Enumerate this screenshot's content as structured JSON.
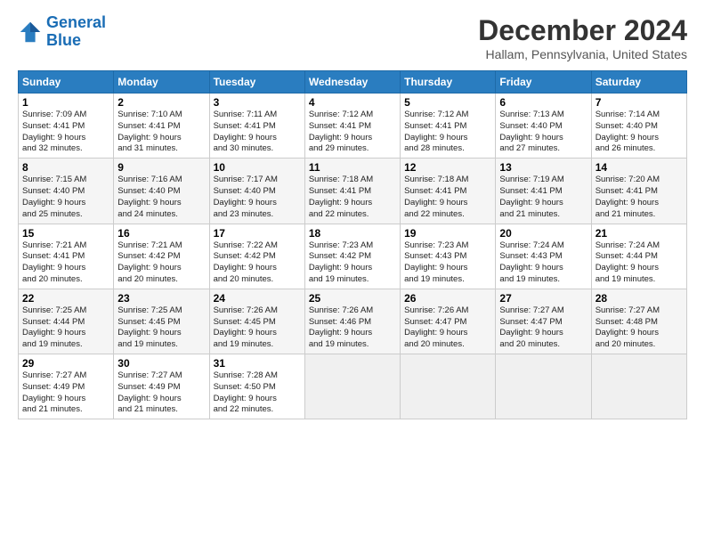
{
  "logo": {
    "line1": "General",
    "line2": "Blue"
  },
  "title": "December 2024",
  "location": "Hallam, Pennsylvania, United States",
  "headers": [
    "Sunday",
    "Monday",
    "Tuesday",
    "Wednesday",
    "Thursday",
    "Friday",
    "Saturday"
  ],
  "weeks": [
    [
      {
        "day": "1",
        "text": "Sunrise: 7:09 AM\nSunset: 4:41 PM\nDaylight: 9 hours\nand 32 minutes."
      },
      {
        "day": "2",
        "text": "Sunrise: 7:10 AM\nSunset: 4:41 PM\nDaylight: 9 hours\nand 31 minutes."
      },
      {
        "day": "3",
        "text": "Sunrise: 7:11 AM\nSunset: 4:41 PM\nDaylight: 9 hours\nand 30 minutes."
      },
      {
        "day": "4",
        "text": "Sunrise: 7:12 AM\nSunset: 4:41 PM\nDaylight: 9 hours\nand 29 minutes."
      },
      {
        "day": "5",
        "text": "Sunrise: 7:12 AM\nSunset: 4:41 PM\nDaylight: 9 hours\nand 28 minutes."
      },
      {
        "day": "6",
        "text": "Sunrise: 7:13 AM\nSunset: 4:40 PM\nDaylight: 9 hours\nand 27 minutes."
      },
      {
        "day": "7",
        "text": "Sunrise: 7:14 AM\nSunset: 4:40 PM\nDaylight: 9 hours\nand 26 minutes."
      }
    ],
    [
      {
        "day": "8",
        "text": "Sunrise: 7:15 AM\nSunset: 4:40 PM\nDaylight: 9 hours\nand 25 minutes."
      },
      {
        "day": "9",
        "text": "Sunrise: 7:16 AM\nSunset: 4:40 PM\nDaylight: 9 hours\nand 24 minutes."
      },
      {
        "day": "10",
        "text": "Sunrise: 7:17 AM\nSunset: 4:40 PM\nDaylight: 9 hours\nand 23 minutes."
      },
      {
        "day": "11",
        "text": "Sunrise: 7:18 AM\nSunset: 4:41 PM\nDaylight: 9 hours\nand 22 minutes."
      },
      {
        "day": "12",
        "text": "Sunrise: 7:18 AM\nSunset: 4:41 PM\nDaylight: 9 hours\nand 22 minutes."
      },
      {
        "day": "13",
        "text": "Sunrise: 7:19 AM\nSunset: 4:41 PM\nDaylight: 9 hours\nand 21 minutes."
      },
      {
        "day": "14",
        "text": "Sunrise: 7:20 AM\nSunset: 4:41 PM\nDaylight: 9 hours\nand 21 minutes."
      }
    ],
    [
      {
        "day": "15",
        "text": "Sunrise: 7:21 AM\nSunset: 4:41 PM\nDaylight: 9 hours\nand 20 minutes."
      },
      {
        "day": "16",
        "text": "Sunrise: 7:21 AM\nSunset: 4:42 PM\nDaylight: 9 hours\nand 20 minutes."
      },
      {
        "day": "17",
        "text": "Sunrise: 7:22 AM\nSunset: 4:42 PM\nDaylight: 9 hours\nand 20 minutes."
      },
      {
        "day": "18",
        "text": "Sunrise: 7:23 AM\nSunset: 4:42 PM\nDaylight: 9 hours\nand 19 minutes."
      },
      {
        "day": "19",
        "text": "Sunrise: 7:23 AM\nSunset: 4:43 PM\nDaylight: 9 hours\nand 19 minutes."
      },
      {
        "day": "20",
        "text": "Sunrise: 7:24 AM\nSunset: 4:43 PM\nDaylight: 9 hours\nand 19 minutes."
      },
      {
        "day": "21",
        "text": "Sunrise: 7:24 AM\nSunset: 4:44 PM\nDaylight: 9 hours\nand 19 minutes."
      }
    ],
    [
      {
        "day": "22",
        "text": "Sunrise: 7:25 AM\nSunset: 4:44 PM\nDaylight: 9 hours\nand 19 minutes."
      },
      {
        "day": "23",
        "text": "Sunrise: 7:25 AM\nSunset: 4:45 PM\nDaylight: 9 hours\nand 19 minutes."
      },
      {
        "day": "24",
        "text": "Sunrise: 7:26 AM\nSunset: 4:45 PM\nDaylight: 9 hours\nand 19 minutes."
      },
      {
        "day": "25",
        "text": "Sunrise: 7:26 AM\nSunset: 4:46 PM\nDaylight: 9 hours\nand 19 minutes."
      },
      {
        "day": "26",
        "text": "Sunrise: 7:26 AM\nSunset: 4:47 PM\nDaylight: 9 hours\nand 20 minutes."
      },
      {
        "day": "27",
        "text": "Sunrise: 7:27 AM\nSunset: 4:47 PM\nDaylight: 9 hours\nand 20 minutes."
      },
      {
        "day": "28",
        "text": "Sunrise: 7:27 AM\nSunset: 4:48 PM\nDaylight: 9 hours\nand 20 minutes."
      }
    ],
    [
      {
        "day": "29",
        "text": "Sunrise: 7:27 AM\nSunset: 4:49 PM\nDaylight: 9 hours\nand 21 minutes."
      },
      {
        "day": "30",
        "text": "Sunrise: 7:27 AM\nSunset: 4:49 PM\nDaylight: 9 hours\nand 21 minutes."
      },
      {
        "day": "31",
        "text": "Sunrise: 7:28 AM\nSunset: 4:50 PM\nDaylight: 9 hours\nand 22 minutes."
      },
      {
        "day": "",
        "text": ""
      },
      {
        "day": "",
        "text": ""
      },
      {
        "day": "",
        "text": ""
      },
      {
        "day": "",
        "text": ""
      }
    ]
  ]
}
